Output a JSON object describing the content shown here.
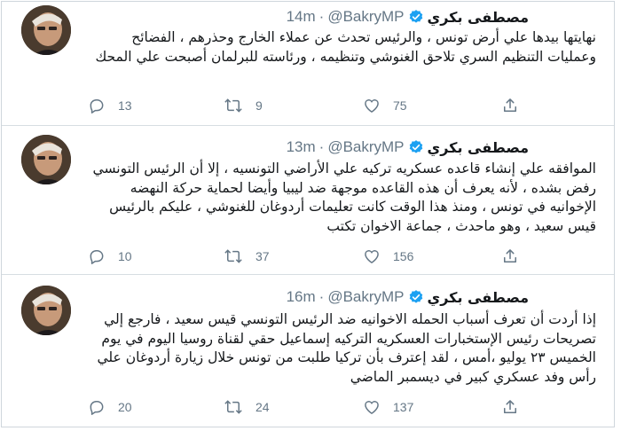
{
  "tweets": [
    {
      "name": "مصطفى بكري",
      "handle": "@BakryMP",
      "separator": "·",
      "time": "14m",
      "text": "نهايتها بيدها علي أرض تونس ، والرئيس تحدث عن عملاء الخارج وحذرهم ، الفضائح وعمليات التنظيم السري تلاحق الغنوشي وتنظيمه ، ورئاسته للبرلمان أصبحت علي المحك",
      "replies": "13",
      "retweets": "9",
      "likes": "75"
    },
    {
      "name": "مصطفى بكري",
      "handle": "@BakryMP",
      "separator": "·",
      "time": "13m",
      "text": "الموافقه علي إنشاء قاعده عسكريه تركيه علي الأراضي التونسيه ، إلا أن الرئيس التونسي رفض بشده ، لأنه يعرف أن هذه القاعده موجهة ضد ليبيا وأيضا لحماية حركة النهضه الإخوانيه في تونس ، ومنذ هذا الوقت كانت تعليمات أردوغان للغنوشي ، عليكم بالرئيس قيس سعيد ، وهو ماحدث ، جماعة الاخوان تكتب",
      "replies": "10",
      "retweets": "37",
      "likes": "156"
    },
    {
      "name": "مصطفى بكري",
      "handle": "@BakryMP",
      "separator": "·",
      "time": "16m",
      "text": "إذا أردت أن تعرف أسباب الحمله الاخوانيه ضد الرئيس التونسي قيس سعيد ، فارجع إلي تصريحات رئيس الإستخبارات العسكريه التركيه إسماعيل حقي لقناة روسيا اليوم في يوم الخميس ٢٣ يوليو ،أمس ، لقد إعترف بأن تركيا طلبت من تونس خلال زيارة أردوغان علي رأس وفد عسكري كبير في ديسمبر الماضي",
      "replies": "20",
      "retweets": "24",
      "likes": "137"
    }
  ],
  "colors": {
    "verified": "#1da1f2",
    "secondary_text": "#657786",
    "divider": "#d7dde2"
  },
  "icons": [
    "reply-icon",
    "retweet-icon",
    "like-icon",
    "share-icon",
    "verified-badge-icon"
  ]
}
